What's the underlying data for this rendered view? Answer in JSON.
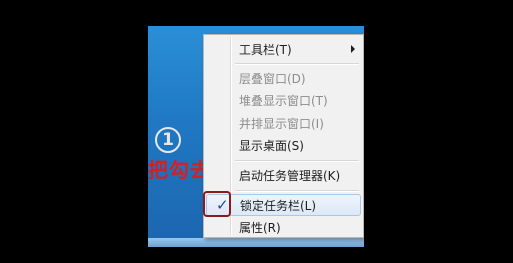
{
  "annotation": {
    "number": "1",
    "instruction": "把勾去掉"
  },
  "menu": {
    "items": [
      {
        "label": "工具栏(T)",
        "enabled": true,
        "submenu": true
      },
      {
        "label": "层叠窗口(D)",
        "enabled": false
      },
      {
        "label": "堆叠显示窗口(T)",
        "enabled": false
      },
      {
        "label": "并排显示窗口(I)",
        "enabled": false
      },
      {
        "label": "显示桌面(S)",
        "enabled": true
      },
      {
        "label": "启动任务管理器(K)",
        "enabled": true
      },
      {
        "label": "锁定任务栏(L)",
        "enabled": true,
        "checked": true,
        "check_mark": "✓"
      },
      {
        "label": "属性(R)",
        "enabled": true
      }
    ]
  },
  "colors": {
    "annotation_text": "#d81e1e",
    "highlight_box": "#8b1a1a",
    "desktop_blue": "#2078c4"
  }
}
